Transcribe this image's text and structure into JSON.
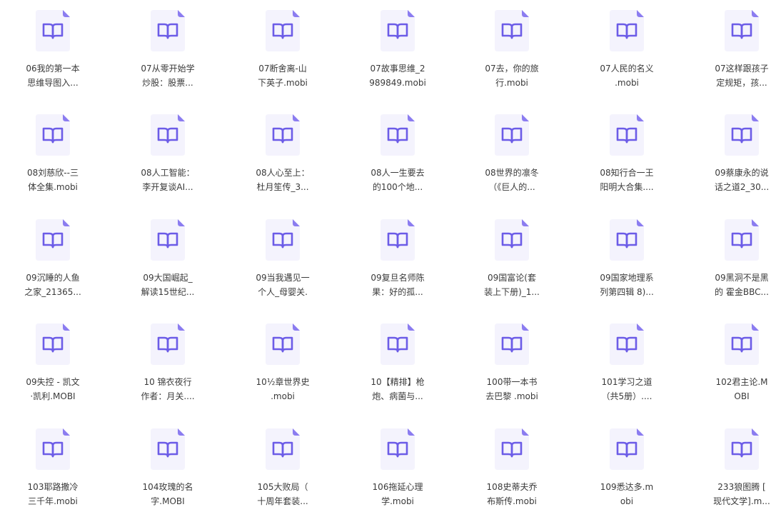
{
  "colors": {
    "background": "#ffffff",
    "icon_page": "#f4f3fd",
    "icon_fold": "#8b7cf0",
    "icon_glyph": "#6c5ce7",
    "label_text": "#3a3a3a"
  },
  "icon": "book-file-icon",
  "files": [
    {
      "lines": [
        "06我的第一本",
        "思维导图入..."
      ]
    },
    {
      "lines": [
        "07从零开始学",
        "炒股：股票..."
      ]
    },
    {
      "lines": [
        "07断舍离-山",
        "下英子.mobi"
      ]
    },
    {
      "lines": [
        "07故事思维_2",
        "989849.mobi"
      ]
    },
    {
      "lines": [
        "07去，你的旅",
        "行.mobi"
      ]
    },
    {
      "lines": [
        "07人民的名义",
        ".mobi"
      ]
    },
    {
      "lines": [
        "07这样跟孩子",
        "定规矩，孩..."
      ]
    },
    {
      "lines": [
        "08刘慈欣--三",
        "体全集.mobi"
      ]
    },
    {
      "lines": [
        "08人工智能：",
        "李开复谈AI..."
      ]
    },
    {
      "lines": [
        "08人心至上：",
        "杜月笙传_3..."
      ]
    },
    {
      "lines": [
        "08人一生要去",
        "的100个地..."
      ]
    },
    {
      "lines": [
        "08世界的凛冬",
        "（《巨人的..."
      ]
    },
    {
      "lines": [
        "08知行合一王",
        "阳明大合集...."
      ]
    },
    {
      "lines": [
        "09蔡康永的说",
        "话之道2_30..."
      ]
    },
    {
      "lines": [
        "09沉睡的人鱼",
        "之家_21365..."
      ]
    },
    {
      "lines": [
        "09大国崛起_",
        "解读15世纪..."
      ]
    },
    {
      "lines": [
        "09当我遇见一",
        "个人_母婴关."
      ]
    },
    {
      "lines": [
        "09复旦名师陈",
        "果：好的孤..."
      ]
    },
    {
      "lines": [
        "09国富论(套",
        "装上下册)_1..."
      ]
    },
    {
      "lines": [
        "09国家地理系",
        "列第四辑 8)..."
      ]
    },
    {
      "lines": [
        "09黑洞不是黑",
        "的 霍金BBC..."
      ]
    },
    {
      "lines": [
        "09失控 - 凯文",
        "·凯利.MOBI"
      ]
    },
    {
      "lines": [
        "10 锦衣夜行",
        "作者：月关...."
      ]
    },
    {
      "lines": [
        "10½章世界史",
        ".mobi"
      ]
    },
    {
      "lines": [
        "10【精排】枪",
        "炮、病菌与..."
      ]
    },
    {
      "lines": [
        "100带一本书",
        "去巴黎 .mobi"
      ]
    },
    {
      "lines": [
        "101学习之道",
        "（共5册）...."
      ]
    },
    {
      "lines": [
        "102君主论.M",
        "OBI"
      ]
    },
    {
      "lines": [
        "103耶路撒冷",
        "三千年.mobi"
      ]
    },
    {
      "lines": [
        "104玫瑰的名",
        "字.MOBI"
      ]
    },
    {
      "lines": [
        "105大败局（",
        "十周年套装..."
      ]
    },
    {
      "lines": [
        "106拖延心理",
        "学.mobi"
      ]
    },
    {
      "lines": [
        "108史蒂夫乔",
        "布斯传.mobi"
      ]
    },
    {
      "lines": [
        "109悉达多.m",
        "obi"
      ]
    },
    {
      "lines": [
        "233狼图腾 [",
        "现代文学].m..."
      ]
    }
  ]
}
